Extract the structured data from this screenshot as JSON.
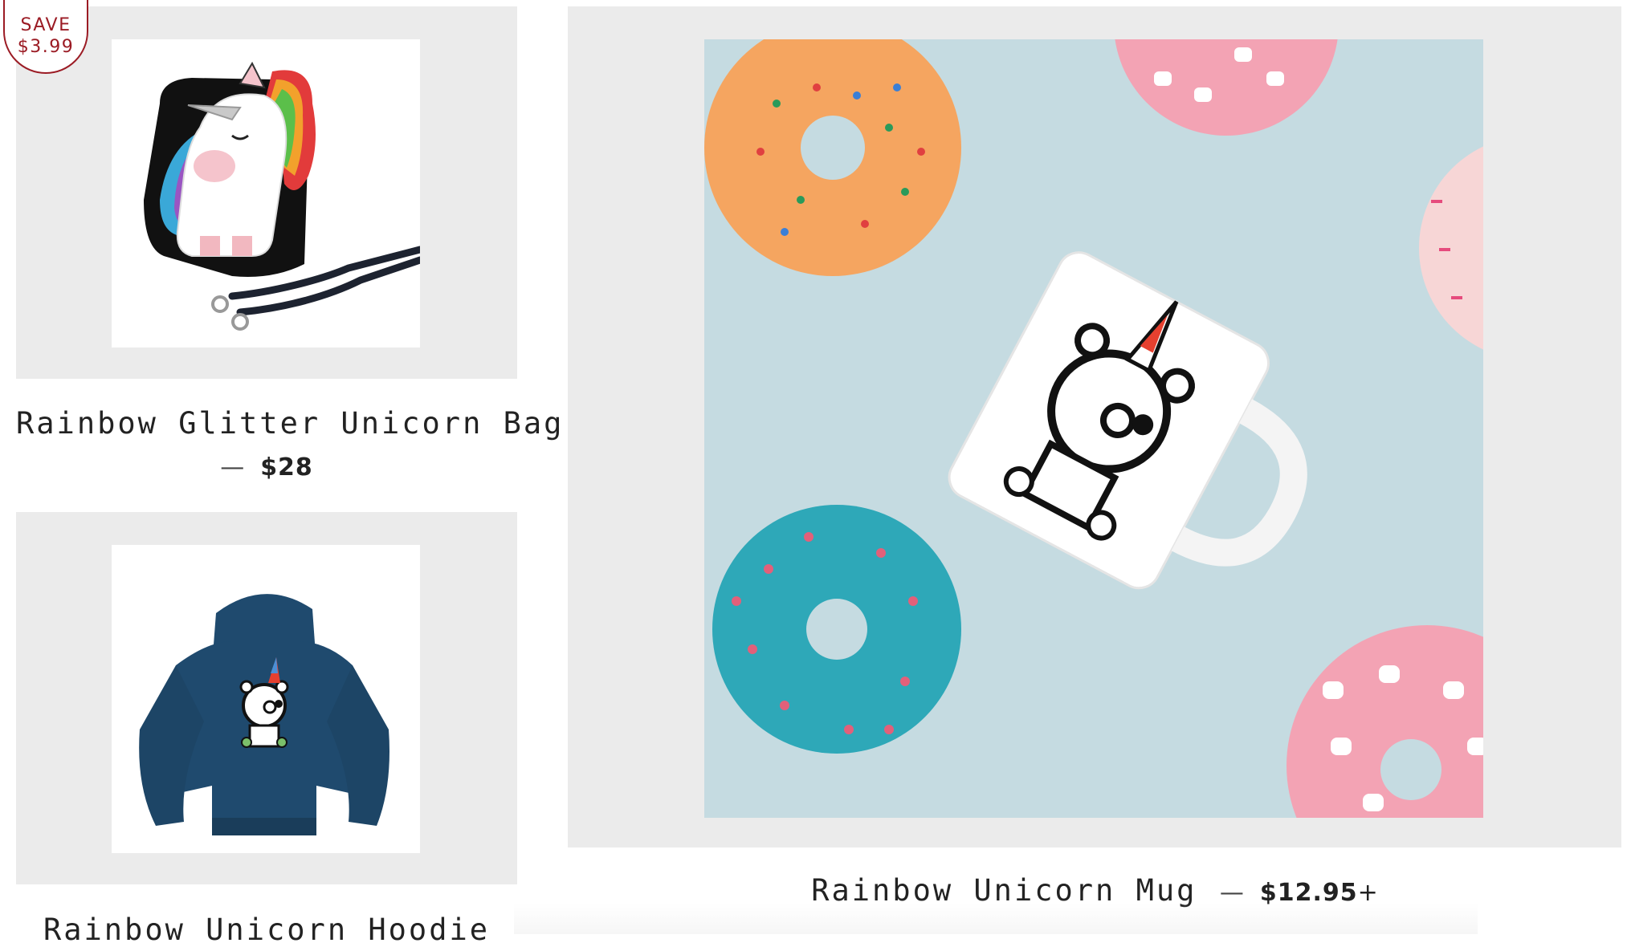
{
  "badge": {
    "line1": "SAVE",
    "line2": "$3.99"
  },
  "products": [
    {
      "title": "Rainbow Glitter Unicorn Bag",
      "dash": "—",
      "price": "$28"
    },
    {
      "title": "Rainbow Unicorn Hoodie"
    },
    {
      "title": "Rainbow Unicorn Mug",
      "dash": "—",
      "price": "$12.95",
      "price_suffix": "+"
    }
  ],
  "colors": {
    "card_background": "#ebebeb",
    "sale_badge": "#9b1b24",
    "hoodie": "#1f4a6e",
    "mug_backdrop": "#c5dbe1"
  },
  "icons": [
    "unicorn-bag-image",
    "hoodie-image",
    "mug-with-donuts-image"
  ]
}
